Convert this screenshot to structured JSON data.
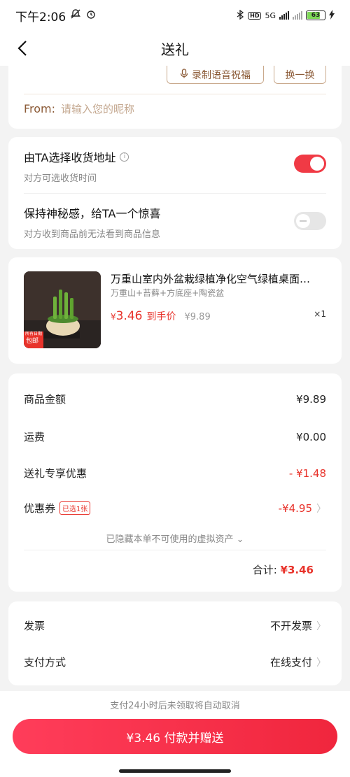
{
  "status_bar": {
    "time": "下午2:06",
    "network": "5G",
    "battery": "63"
  },
  "header": {
    "title": "送礼"
  },
  "greeting": {
    "voice_button": "录制语音祝福",
    "swap_button": "换一换",
    "from_label": "From:",
    "from_placeholder": "请输入您的昵称"
  },
  "options": [
    {
      "title": "由TA选择收货地址",
      "subtitle": "对方可选收货时间",
      "enabled": true
    },
    {
      "title": "保持神秘感，给TA一个惊喜",
      "subtitle": "对方收到商品前无法看到商品信息",
      "enabled": false
    }
  ],
  "product": {
    "name": "万重山室内外盆栽绿植净化空气绿植桌面…",
    "spec": "万重山+苔藓+方底座+陶瓷盆",
    "price_symbol": "¥",
    "price": "3.46",
    "price_label": "到手价",
    "original_price": "¥9.89",
    "quantity": "×1",
    "image_badge": "包邮",
    "image_caption": "所有日期"
  },
  "summary": {
    "rows": [
      {
        "label": "商品金额",
        "value": "¥9.89"
      },
      {
        "label": "运费",
        "value": "¥0.00"
      },
      {
        "label": "送礼专享优惠",
        "value": "- ¥1.48"
      },
      {
        "label": "优惠券",
        "badge": "已选1张",
        "value": "-¥4.95"
      }
    ],
    "hidden_note": "已隐藏本单不可使用的虚拟资产",
    "total_label": "合计:",
    "total_value": "¥3.46"
  },
  "invoice": {
    "rows": [
      {
        "label": "发票",
        "value": "不开发票"
      },
      {
        "label": "支付方式",
        "value": "在线支付"
      }
    ]
  },
  "footer": {
    "notice": "支付24小时后未领取将自动取消",
    "pay_button": "¥3.46 付款并赠送"
  },
  "colors": {
    "accent": "#f03a45",
    "price": "#e8332b",
    "brown": "#8b5a36"
  }
}
